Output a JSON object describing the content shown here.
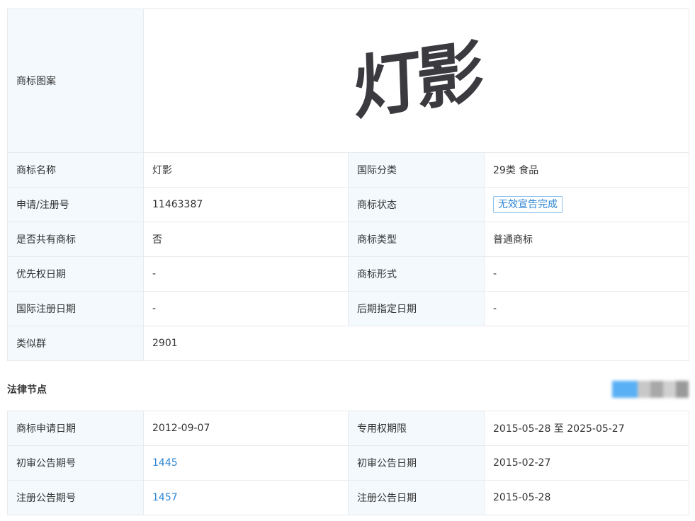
{
  "info": {
    "logo_label": "商标图案",
    "logo_text": "灯影",
    "rows": [
      {
        "l1": "商标名称",
        "v1": "灯影",
        "l2": "国际分类",
        "v2": "29类 食品"
      },
      {
        "l1": "申请/注册号",
        "v1": "11463387",
        "l2": "商标状态",
        "v2": "无效宣告完成"
      },
      {
        "l1": "是否共有商标",
        "v1": "否",
        "l2": "商标类型",
        "v2": "普通商标"
      },
      {
        "l1": "优先权日期",
        "v1": "-",
        "l2": "商标形式",
        "v2": "-"
      },
      {
        "l1": "国际注册日期",
        "v1": "-",
        "l2": "后期指定日期",
        "v2": "-"
      }
    ],
    "similar_group_label": "类似群",
    "similar_group_value": "2901"
  },
  "legal": {
    "section_title": "法律节点",
    "rows": [
      {
        "l1": "商标申请日期",
        "v1": "2012-09-07",
        "l2": "专用权期限",
        "v2": "2015-05-28 至 2025-05-27"
      },
      {
        "l1": "初审公告期号",
        "v1": "1445",
        "l2": "初审公告日期",
        "v2": "2015-02-27"
      },
      {
        "l1": "注册公告期号",
        "v1": "1457",
        "l2": "注册公告日期",
        "v2": "2015-05-28"
      }
    ]
  },
  "colors": {
    "label_bg": "#f3f9fd",
    "border": "#e8eaee",
    "link": "#2f86d6",
    "badge_border": "#8ec3ee"
  }
}
